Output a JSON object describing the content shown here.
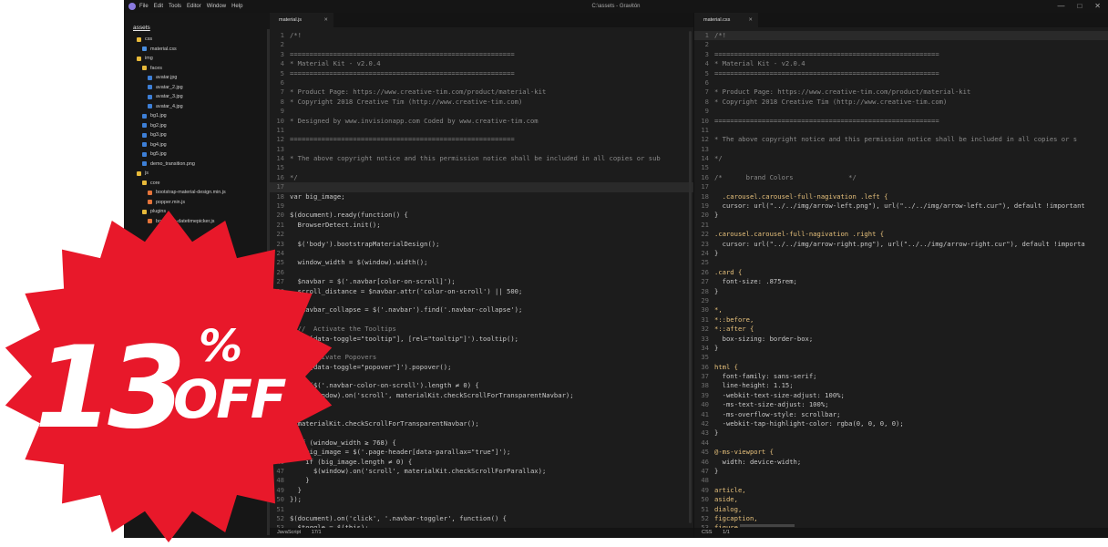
{
  "window": {
    "title": "C:\\assets - Gravitón",
    "menu": [
      "File",
      "Edit",
      "Tools",
      "Editor",
      "Window",
      "Help"
    ],
    "controls": [
      "—",
      "□",
      "✕"
    ]
  },
  "sidebar": {
    "root": "assets",
    "items": [
      {
        "label": "css",
        "type": "folder",
        "depth": 1
      },
      {
        "label": "material.css",
        "type": "css",
        "depth": 2
      },
      {
        "label": "img",
        "type": "folder",
        "depth": 1
      },
      {
        "label": "faces",
        "type": "folder",
        "depth": 2
      },
      {
        "label": "avatar.jpg",
        "type": "img",
        "depth": 3
      },
      {
        "label": "avatar_2.jpg",
        "type": "img",
        "depth": 3
      },
      {
        "label": "avatar_3.jpg",
        "type": "img",
        "depth": 3
      },
      {
        "label": "avatar_4.jpg",
        "type": "img",
        "depth": 3
      },
      {
        "label": "bg1.jpg",
        "type": "img",
        "depth": 2
      },
      {
        "label": "bg2.jpg",
        "type": "img",
        "depth": 2
      },
      {
        "label": "bg3.jpg",
        "type": "img",
        "depth": 2
      },
      {
        "label": "bg4.jpg",
        "type": "img",
        "depth": 2
      },
      {
        "label": "bg5.jpg",
        "type": "img",
        "depth": 2
      },
      {
        "label": "demo_transition.png",
        "type": "img",
        "depth": 2
      },
      {
        "label": "js",
        "type": "folder",
        "depth": 1
      },
      {
        "label": "core",
        "type": "folder",
        "depth": 2
      },
      {
        "label": "bootstrap-material-design.min.js",
        "type": "js",
        "depth": 3
      },
      {
        "label": "popper.min.js",
        "type": "js",
        "depth": 3
      },
      {
        "label": "plugins",
        "type": "folder",
        "depth": 2
      },
      {
        "label": "bootstrap-datetimepicker.js",
        "type": "js",
        "depth": 3
      }
    ]
  },
  "editor_left": {
    "tab": "material.js",
    "status_lang": "JavaScript",
    "status_pos": "17/1",
    "current_line": 17,
    "lines": [
      "/*!",
      "",
      "=========================================================",
      "* Material Kit - v2.0.4",
      "=========================================================",
      "",
      "* Product Page: https://www.creative-tim.com/product/material-kit",
      "* Copyright 2018 Creative Tim (http://www.creative-tim.com)",
      "",
      "* Designed by www.invisionapp.com Coded by www.creative-tim.com",
      "",
      "=========================================================",
      "",
      "* The above copyright notice and this permission notice shall be included in all copies or sub",
      "",
      "*/",
      "",
      "var big_image;",
      "",
      "$(document).ready(function() {",
      "  BrowserDetect.init();",
      "",
      "  $('body').bootstrapMaterialDesign();",
      "",
      "  window_width = $(window).width();",
      "",
      "  $navbar = $('.navbar[color-on-scroll]');",
      "  scroll_distance = $navbar.attr('color-on-scroll') || 500;",
      "",
      "  $navbar_collapse = $('.navbar').find('.navbar-collapse');",
      "",
      "  //  Activate the Tooltips",
      "  $('[data-toggle=\"tooltip\"], [rel=\"tooltip\"]').tooltip();",
      "",
      "  // Activate Popovers",
      "  $('[data-toggle=\"popover\"]').popover();",
      "",
      "  if ($('.navbar-color-on-scroll').length ≠ 0) {",
      "    $(window).on('scroll', materialKit.checkScrollForTransparentNavbar);",
      "  }",
      "",
      "  materialKit.checkScrollForTransparentNavbar();",
      "",
      "  if (window_width ≥ 768) {",
      "    big_image = $('.page-header[data-parallax=\"true\"]');",
      "    if (big_image.length ≠ 0) {",
      "      $(window).on('scroll', materialKit.checkScrollForParallax);",
      "    }",
      "  }",
      "});",
      "",
      "$(document).on('click', '.navbar-toggler', function() {",
      "  $toggle = $(this);"
    ]
  },
  "editor_right": {
    "tab": "material.css",
    "status_lang": "CSS",
    "status_pos": "1/1",
    "current_line": 1,
    "lines": [
      "/*!",
      "",
      "=========================================================",
      "* Material Kit - v2.0.4",
      "=========================================================",
      "",
      "* Product Page: https://www.creative-tim.com/product/material-kit",
      "* Copyright 2018 Creative Tim (http://www.creative-tim.com)",
      "",
      "=========================================================",
      "",
      "* The above copyright notice and this permission notice shall be included in all copies or s",
      "",
      "*/",
      "",
      "/*      brand Colors              */",
      "",
      "  .carousel.carousel-full-nagivation .left {",
      "  cursor: url(\"../../img/arrow-left.png\"), url(\"../../img/arrow-left.cur\"), default !important",
      "}",
      "",
      ".carousel.carousel-full-nagivation .right {",
      "  cursor: url(\"../../img/arrow-right.png\"), url(\"../../img/arrow-right.cur\"), default !importa",
      "}",
      "",
      ".card {",
      "  font-size: .875rem;",
      "}",
      "",
      "*,",
      "*::before,",
      "*::after {",
      "  box-sizing: border-box;",
      "}",
      "",
      "html {",
      "  font-family: sans-serif;",
      "  line-height: 1.15;",
      "  -webkit-text-size-adjust: 100%;",
      "  -ms-text-size-adjust: 100%;",
      "  -ms-overflow-style: scrollbar;",
      "  -webkit-tap-highlight-color: rgba(0, 0, 0, 0);",
      "}",
      "",
      "@-ms-viewport {",
      "  width: device-width;",
      "}",
      "",
      "article,",
      "aside,",
      "dialog,",
      "figcaption,",
      "figure,"
    ]
  },
  "promo": {
    "number": "13",
    "percent": "%",
    "word": "OFF",
    "color": "#e8182a"
  }
}
